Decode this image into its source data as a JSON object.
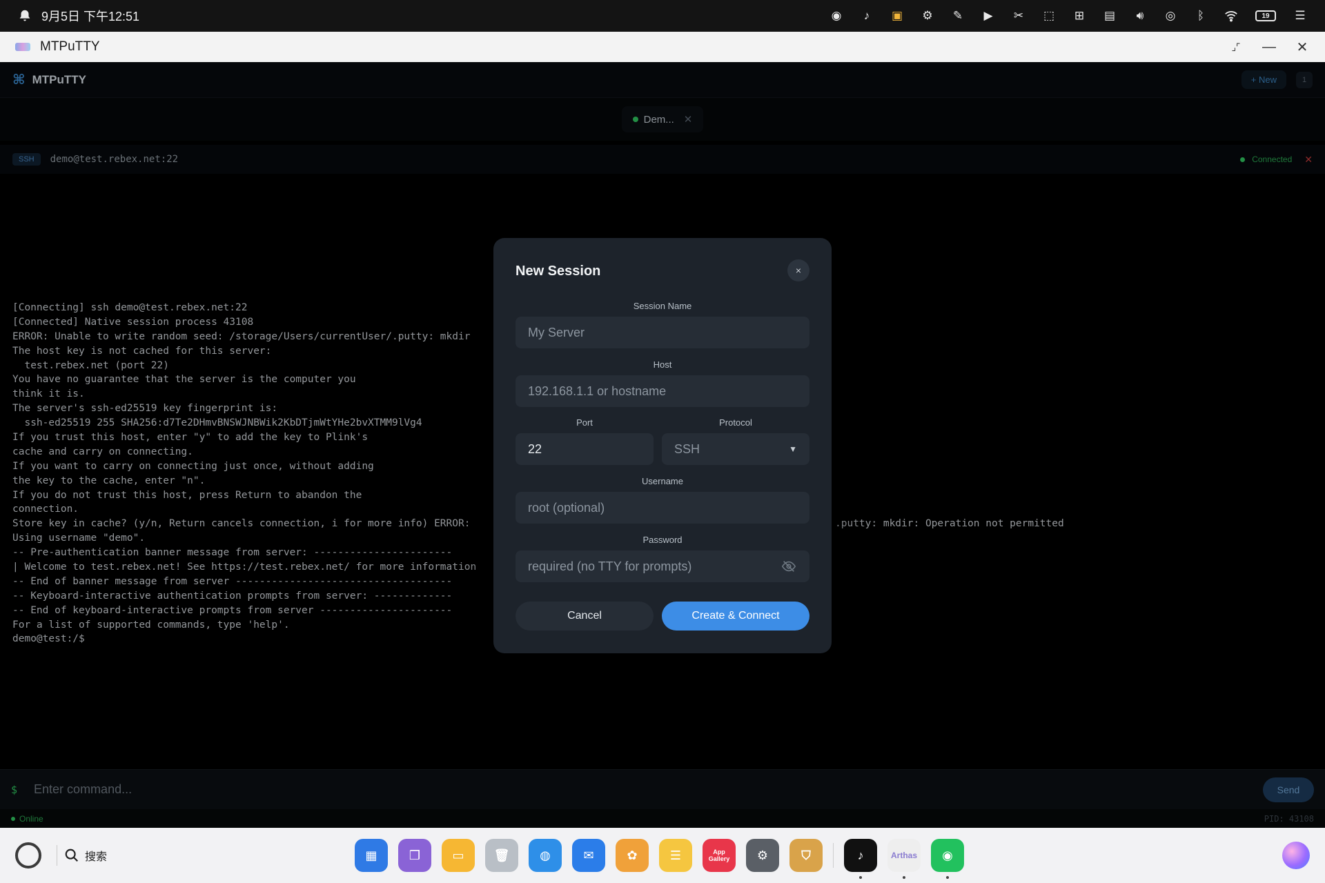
{
  "system_bar": {
    "datetime": "9月5日 下午12:51",
    "battery": "19",
    "icons": [
      "bell-icon",
      "wechat-icon",
      "tiktok-icon",
      "app-icon",
      "settings-gear-icon",
      "notes-icon",
      "video-icon",
      "scissors-icon",
      "screenshot-icon",
      "translate-icon",
      "display-icon",
      "volume-icon",
      "nfc-icon",
      "bluetooth-icon",
      "wifi-icon",
      "battery-icon",
      "control-center-icon"
    ]
  },
  "window": {
    "title": "MTPuTTY"
  },
  "app_header": {
    "brand": "MTPuTTY",
    "new_button": "+ New",
    "session_count": "1"
  },
  "tabs": [
    {
      "label": "Dem...",
      "status": "connected"
    }
  ],
  "session": {
    "protocol": "SSH",
    "host": "demo@test.rebex.net:22",
    "status": "Connected"
  },
  "terminal": {
    "lines": [
      "[Connecting] ssh demo@test.rebex.net:22",
      "[Connected] Native session process 43108",
      "ERROR: Unable to write random seed: /storage/Users/currentUser/.putty: mkdir",
      "The host key is not cached for this server:",
      "  test.rebex.net (port 22)",
      "You have no guarantee that the server is the computer you",
      "think it is.",
      "The server's ssh-ed25519 key fingerprint is:",
      "  ssh-ed25519 255 SHA256:d7Te2DHmvBNSWJNBWik2KbDTjmWtYHe2bvXTMM9lVg4",
      "If you trust this host, enter \"y\" to add the key to Plink's",
      "cache and carry on connecting.",
      "If you want to carry on connecting just once, without adding",
      "the key to the cache, enter \"n\".",
      "If you do not trust this host, press Return to abandon the",
      "connection.",
      "Store key in cache? (y/n, Return cancels connection, i for more info) ERROR:",
      "Using username \"demo\".",
      "-- Pre-authentication banner message from server: -----------------------",
      "| Welcome to test.rebex.net! See https://test.rebex.net/ for more information",
      "-- End of banner message from server ------------------------------------",
      "-- Keyboard-interactive authentication prompts from server: -------------",
      "-- End of keyboard-interactive prompts from server ----------------------",
      "For a list of supported commands, type 'help'.",
      "demo@test:/$"
    ],
    "overflow_right": ".putty: mkdir: Operation not permitted"
  },
  "modal": {
    "title": "New Session",
    "close": "×",
    "session_name_label": "Session Name",
    "session_name_placeholder": "My Server",
    "host_label": "Host",
    "host_placeholder": "192.168.1.1 or hostname",
    "port_label": "Port",
    "port_value": "22",
    "protocol_label": "Protocol",
    "protocol_value": "SSH",
    "username_label": "Username",
    "username_placeholder": "root (optional)",
    "password_label": "Password",
    "password_placeholder": "required (no TTY for prompts)",
    "cancel_label": "Cancel",
    "create_label": "Create & Connect"
  },
  "command_bar": {
    "prompt": "$",
    "placeholder": "Enter command...",
    "send_label": "Send"
  },
  "footer": {
    "status": "Online",
    "pid": "PID: 43108"
  },
  "dock": {
    "search_label": "搜索",
    "apps": [
      {
        "name": "launcher-app",
        "color": "#2f7ae5"
      },
      {
        "name": "multitask-app",
        "color": "#8a63d6"
      },
      {
        "name": "files-app",
        "color": "#f6b733"
      },
      {
        "name": "trash-app",
        "color": "#b9bfc6"
      },
      {
        "name": "browser-app",
        "color": "#2e8fe8"
      },
      {
        "name": "mail-app",
        "color": "#2b7de9"
      },
      {
        "name": "photos-app",
        "color": "#f0a13a"
      },
      {
        "name": "notes-app",
        "color": "#f5c640"
      },
      {
        "name": "app-gallery",
        "label": "App Gallery",
        "color": "#e8364a"
      },
      {
        "name": "settings-app",
        "color": "#5a5f66"
      },
      {
        "name": "security-app",
        "color": "#d9a34a"
      },
      {
        "name": "tiktok-app",
        "color": "#111111"
      },
      {
        "name": "arthas-app",
        "label": "Arthas",
        "color": "#eeeeee"
      },
      {
        "name": "wechat-app",
        "color": "#22c15e"
      }
    ]
  }
}
